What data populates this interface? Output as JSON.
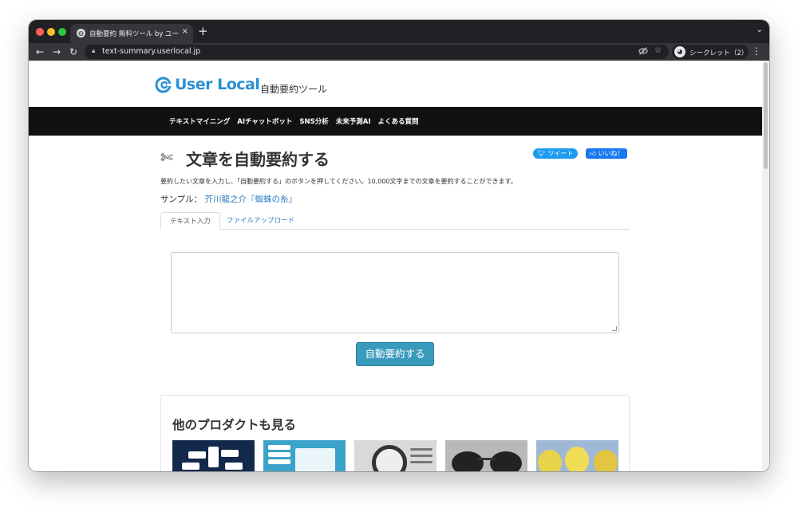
{
  "browser": {
    "tab_title": "自動要約 無料ツール by ユーザーロ",
    "tab_close": "×",
    "new_tab": "+",
    "url": "text-summary.userlocal.jp",
    "profile_label": "シークレット（2）",
    "icons": [
      "back-icon",
      "forward-icon",
      "reload-icon",
      "lock-icon",
      "eye-off-icon",
      "star-icon",
      "incognito-icon",
      "menu-icon"
    ]
  },
  "site": {
    "logo_text": "User Local",
    "logo_sub": "自動要約ツール",
    "brand_color": "#2b8fd1",
    "nav": [
      "テキストマイニング",
      "AIチャットボット",
      "SNS分析",
      "未来予測AI",
      "よくある質問"
    ]
  },
  "main": {
    "title": "文章を自動要約する",
    "tweet_label": "ツイート",
    "like_label": "いいね！",
    "description": "要約したい文章を入力し、「自動要約する」のボタンを押してください。10,000文字までの文章を要約することができます。",
    "sample_label": "サンプル：",
    "sample_link": "芥川龍之介『蜘蛛の糸』",
    "tabs": [
      "テキスト入力",
      "ファイルアップロード"
    ],
    "textarea_value": "",
    "submit_label": "自動要約する",
    "accent_color": "#3a9bbc"
  },
  "products": {
    "title": "他のプロダクトも見る"
  }
}
